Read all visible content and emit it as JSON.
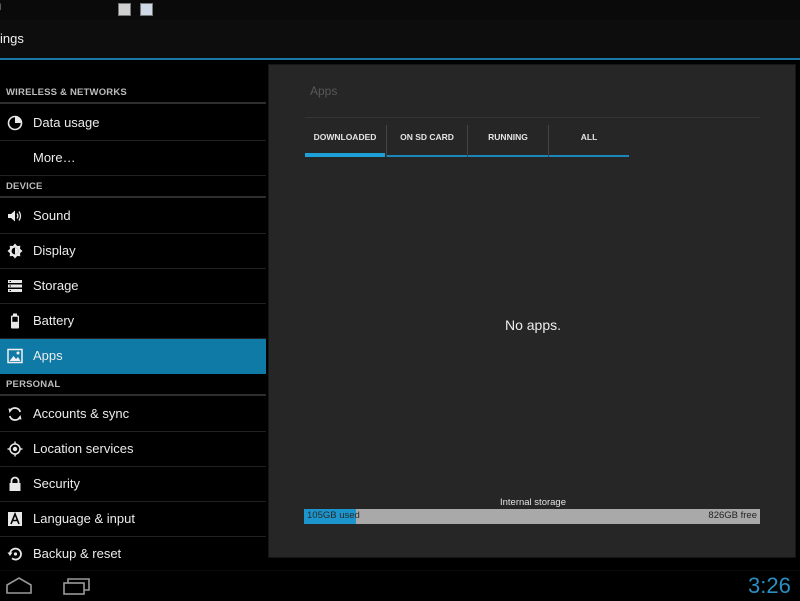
{
  "window": {
    "title": "oid"
  },
  "action_bar": {
    "title": "ings"
  },
  "sidebar": {
    "sections": [
      {
        "header": "WIRELESS & NETWORKS",
        "items": [
          {
            "label": "Data usage",
            "icon": "data-usage-icon"
          },
          {
            "label": "More…",
            "icon": ""
          }
        ]
      },
      {
        "header": "DEVICE",
        "items": [
          {
            "label": "Sound",
            "icon": "speaker-icon"
          },
          {
            "label": "Display",
            "icon": "brightness-icon"
          },
          {
            "label": "Storage",
            "icon": "storage-icon"
          },
          {
            "label": "Battery",
            "icon": "battery-icon"
          },
          {
            "label": "Apps",
            "icon": "apps-icon",
            "selected": true
          }
        ]
      },
      {
        "header": "PERSONAL",
        "items": [
          {
            "label": "Accounts & sync",
            "icon": "sync-icon"
          },
          {
            "label": "Location services",
            "icon": "location-icon"
          },
          {
            "label": "Security",
            "icon": "lock-icon"
          },
          {
            "label": "Language & input",
            "icon": "language-icon"
          },
          {
            "label": "Backup & reset",
            "icon": "backup-icon"
          }
        ]
      }
    ]
  },
  "main": {
    "title": "Apps",
    "tabs": [
      {
        "label": "DOWNLOADED",
        "active": true
      },
      {
        "label": "ON SD CARD",
        "active": false
      },
      {
        "label": "RUNNING",
        "active": false
      },
      {
        "label": "ALL",
        "active": false
      }
    ],
    "empty_message": "No apps.",
    "storage": {
      "label": "Internal storage",
      "used": "105GB used",
      "free": "826GB free",
      "used_fraction": 0.113
    }
  },
  "system_bar": {
    "clock": "3:26"
  },
  "colors": {
    "accent": "#0f7aa6",
    "accent_bright": "#1da0d8",
    "panel_bg": "#262626",
    "storage_free": "#a9a9a9"
  }
}
